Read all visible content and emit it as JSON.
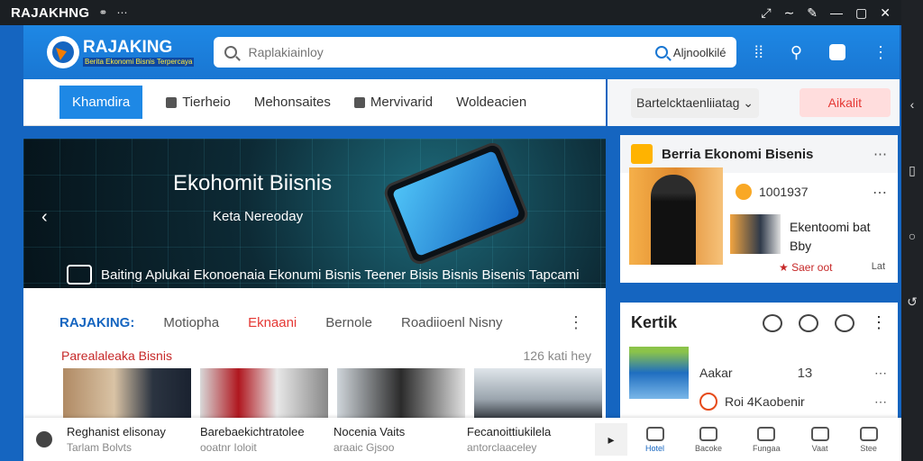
{
  "window": {
    "title": "RAJAKHNG",
    "controls": [
      "⤢",
      "∼",
      "✎",
      "—",
      "▢",
      "✕"
    ]
  },
  "appbar": {
    "logo_name": "RAJAKING",
    "logo_tagline": "Berita Ekonomi Bisnis Terpercaya",
    "search_placeholder": "Raplakiainloy",
    "search_action": "Aljnoolkilé"
  },
  "tabs": [
    {
      "label": "Khamdira",
      "active": true
    },
    {
      "label": "Tierheio"
    },
    {
      "label": "Mehonsaites"
    },
    {
      "label": "Mervivarid"
    },
    {
      "label": "Woldeacien"
    }
  ],
  "filter": {
    "dropdown": "Bartelcktaenliiatag",
    "button": "Aikalit"
  },
  "hero": {
    "title": "Ekohomit Biisnis",
    "subtitle": "Keta Nereoday",
    "caption": "Baiting Aplukai Ekonoenaia Ekonumi Bisnis Teener Bisis Bisnis Bisenis Tapcami"
  },
  "section": {
    "brand": "RAJAKING:",
    "tabs": [
      "Motiopha",
      "Eknaani",
      "Bernole",
      "Roadiioenl Nisny"
    ],
    "subtitle": "Parealaleaka Bisnis",
    "meta": "126 kati hey"
  },
  "bottom_cards": [
    {
      "title": "Reghanist elisonay",
      "meta": "Tarlam Bolvts"
    },
    {
      "title": "Barebaekichtratolee",
      "meta": "ooatnr Ioloit"
    },
    {
      "title": "Nocenia Vaits",
      "meta": "araaic Gjsoo"
    },
    {
      "title": "Fecanoittiukilela",
      "meta": "antorclaaceley"
    }
  ],
  "bottom_nav": [
    {
      "label": "Hotel",
      "active": true
    },
    {
      "label": "Bacoke"
    },
    {
      "label": "Fungaa"
    },
    {
      "label": "Vaat"
    },
    {
      "label": "Stee"
    }
  ],
  "right_card1": {
    "title": "Berria Ekonomi Bisenis",
    "meta": "1001937",
    "story_title": "Ekentoomi bat",
    "story_sub": "Bby",
    "footer": "★ Saer oot",
    "footer2": "Lat"
  },
  "right_card2": {
    "title": "Kertik",
    "user": "Aakar",
    "count": "13",
    "user2": "Roi 4Kaobenir"
  },
  "colors": {
    "accent": "#1e88e5",
    "alert": "#e53935",
    "dark": "#1b1f23"
  }
}
